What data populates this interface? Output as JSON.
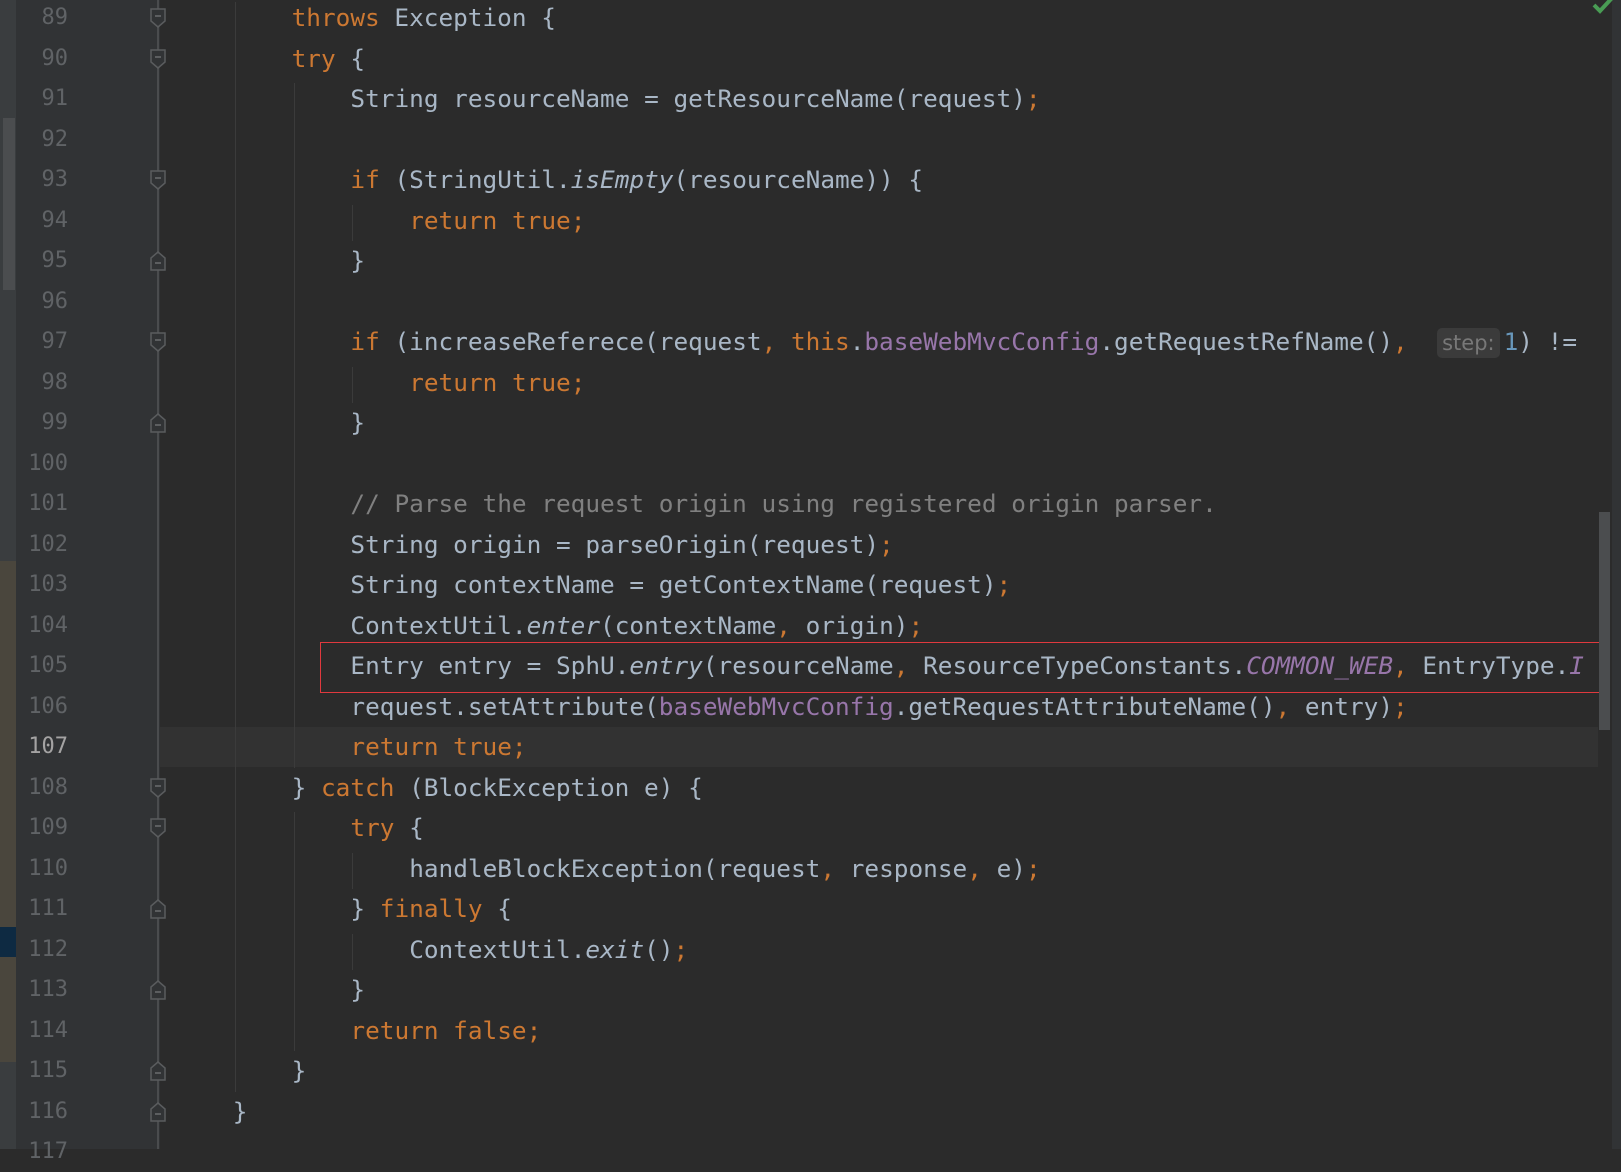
{
  "editor": {
    "current_line": 107,
    "status_icon": "check-icon",
    "colors": {
      "keyword": "#cc7832",
      "text": "#a9b7c6",
      "field": "#9876aa",
      "comment": "#808080",
      "number": "#6897bb",
      "highlight_box": "#e0393e",
      "status_ok": "#499c54"
    },
    "lines": [
      {
        "num": "89",
        "indent": 8,
        "fold": "start",
        "tokens": [
          {
            "t": "throws",
            "s": "k"
          },
          {
            "t": " Exception {",
            "s": ""
          }
        ]
      },
      {
        "num": "90",
        "indent": 8,
        "fold": "start",
        "tokens": [
          {
            "t": "try",
            "s": "k"
          },
          {
            "t": " {",
            "s": ""
          }
        ]
      },
      {
        "num": "91",
        "indent": 12,
        "tokens": [
          {
            "t": "String resourceName = getResourceName(request)",
            "s": ""
          },
          {
            "t": ";",
            "s": "p"
          }
        ]
      },
      {
        "num": "92",
        "indent": 12,
        "tokens": []
      },
      {
        "num": "93",
        "indent": 12,
        "fold": "start",
        "tokens": [
          {
            "t": "if",
            "s": "k"
          },
          {
            "t": " (StringUtil.",
            "s": ""
          },
          {
            "t": "isEmpty",
            "s": "i"
          },
          {
            "t": "(resourceName)) {",
            "s": ""
          }
        ]
      },
      {
        "num": "94",
        "indent": 16,
        "tokens": [
          {
            "t": "return true;",
            "s": "k"
          }
        ]
      },
      {
        "num": "95",
        "indent": 12,
        "fold": "end",
        "tokens": [
          {
            "t": "}",
            "s": ""
          }
        ]
      },
      {
        "num": "96",
        "indent": 12,
        "tokens": []
      },
      {
        "num": "97",
        "indent": 12,
        "fold": "start",
        "tokens": [
          {
            "t": "if",
            "s": "k"
          },
          {
            "t": " (increaseReferece(request",
            "s": ""
          },
          {
            "t": ", ",
            "s": "p"
          },
          {
            "t": "this",
            "s": "k"
          },
          {
            "t": ".",
            "s": ""
          },
          {
            "t": "baseWebMvcConfig",
            "s": "f"
          },
          {
            "t": ".getRequestRefName()",
            "s": ""
          },
          {
            "t": ",  ",
            "s": "p"
          },
          {
            "t": "step:",
            "s": "hint"
          },
          {
            "t": "1",
            "s": "n"
          },
          {
            "t": ") !=",
            "s": ""
          }
        ]
      },
      {
        "num": "98",
        "indent": 16,
        "tokens": [
          {
            "t": "return true;",
            "s": "k"
          }
        ]
      },
      {
        "num": "99",
        "indent": 12,
        "fold": "end",
        "tokens": [
          {
            "t": "}",
            "s": ""
          }
        ]
      },
      {
        "num": "100",
        "indent": 12,
        "tokens": []
      },
      {
        "num": "101",
        "indent": 12,
        "tokens": [
          {
            "t": "// Parse the request origin using registered origin parser.",
            "s": "c"
          }
        ]
      },
      {
        "num": "102",
        "indent": 12,
        "tokens": [
          {
            "t": "String origin = parseOrigin(request)",
            "s": ""
          },
          {
            "t": ";",
            "s": "p"
          }
        ]
      },
      {
        "num": "103",
        "indent": 12,
        "tokens": [
          {
            "t": "String contextName = getContextName(request)",
            "s": ""
          },
          {
            "t": ";",
            "s": "p"
          }
        ]
      },
      {
        "num": "104",
        "indent": 12,
        "tokens": [
          {
            "t": "ContextUtil.",
            "s": ""
          },
          {
            "t": "enter",
            "s": "i"
          },
          {
            "t": "(contextName",
            "s": ""
          },
          {
            "t": ", ",
            "s": "p"
          },
          {
            "t": "origin)",
            "s": ""
          },
          {
            "t": ";",
            "s": "p"
          }
        ]
      },
      {
        "num": "105",
        "indent": 12,
        "tokens": [
          {
            "t": "Entry entry = SphU.",
            "s": ""
          },
          {
            "t": "entry",
            "s": "i"
          },
          {
            "t": "(resourceName",
            "s": ""
          },
          {
            "t": ", ",
            "s": "p"
          },
          {
            "t": "ResourceTypeConstants.",
            "s": ""
          },
          {
            "t": "COMMON_WEB",
            "s": "fi"
          },
          {
            "t": ", ",
            "s": "p"
          },
          {
            "t": "EntryType.",
            "s": ""
          },
          {
            "t": "I",
            "s": "fi"
          }
        ]
      },
      {
        "num": "106",
        "indent": 12,
        "tokens": [
          {
            "t": "request.setAttribute(",
            "s": ""
          },
          {
            "t": "baseWebMvcConfig",
            "s": "f"
          },
          {
            "t": ".getRequestAttributeName()",
            "s": ""
          },
          {
            "t": ", ",
            "s": "p"
          },
          {
            "t": "entry)",
            "s": ""
          },
          {
            "t": ";",
            "s": "p"
          }
        ]
      },
      {
        "num": "107",
        "indent": 12,
        "tokens": [
          {
            "t": "return true;",
            "s": "k"
          }
        ]
      },
      {
        "num": "108",
        "indent": 8,
        "fold": "start",
        "tokens": [
          {
            "t": "} ",
            "s": ""
          },
          {
            "t": "catch",
            "s": "k"
          },
          {
            "t": " (BlockException e) {",
            "s": ""
          }
        ]
      },
      {
        "num": "109",
        "indent": 12,
        "fold": "start",
        "tokens": [
          {
            "t": "try",
            "s": "k"
          },
          {
            "t": " {",
            "s": ""
          }
        ]
      },
      {
        "num": "110",
        "indent": 16,
        "tokens": [
          {
            "t": "handleBlockException(request",
            "s": ""
          },
          {
            "t": ", ",
            "s": "p"
          },
          {
            "t": "response",
            "s": ""
          },
          {
            "t": ", ",
            "s": "p"
          },
          {
            "t": "e)",
            "s": ""
          },
          {
            "t": ";",
            "s": "p"
          }
        ]
      },
      {
        "num": "111",
        "indent": 12,
        "fold": "end",
        "tokens": [
          {
            "t": "} ",
            "s": ""
          },
          {
            "t": "finally",
            "s": "k"
          },
          {
            "t": " {",
            "s": ""
          }
        ]
      },
      {
        "num": "112",
        "indent": 16,
        "tokens": [
          {
            "t": "ContextUtil.",
            "s": ""
          },
          {
            "t": "exit",
            "s": "i"
          },
          {
            "t": "()",
            "s": ""
          },
          {
            "t": ";",
            "s": "p"
          }
        ]
      },
      {
        "num": "113",
        "indent": 12,
        "fold": "end",
        "tokens": [
          {
            "t": "}",
            "s": ""
          }
        ]
      },
      {
        "num": "114",
        "indent": 12,
        "tokens": [
          {
            "t": "return false;",
            "s": "k"
          }
        ]
      },
      {
        "num": "115",
        "indent": 8,
        "fold": "end",
        "tokens": [
          {
            "t": "}",
            "s": ""
          }
        ]
      },
      {
        "num": "116",
        "indent": 4,
        "fold": "end",
        "tokens": [
          {
            "t": "}",
            "s": ""
          }
        ]
      },
      {
        "num": "117",
        "indent": 0,
        "tokens": []
      }
    ]
  }
}
